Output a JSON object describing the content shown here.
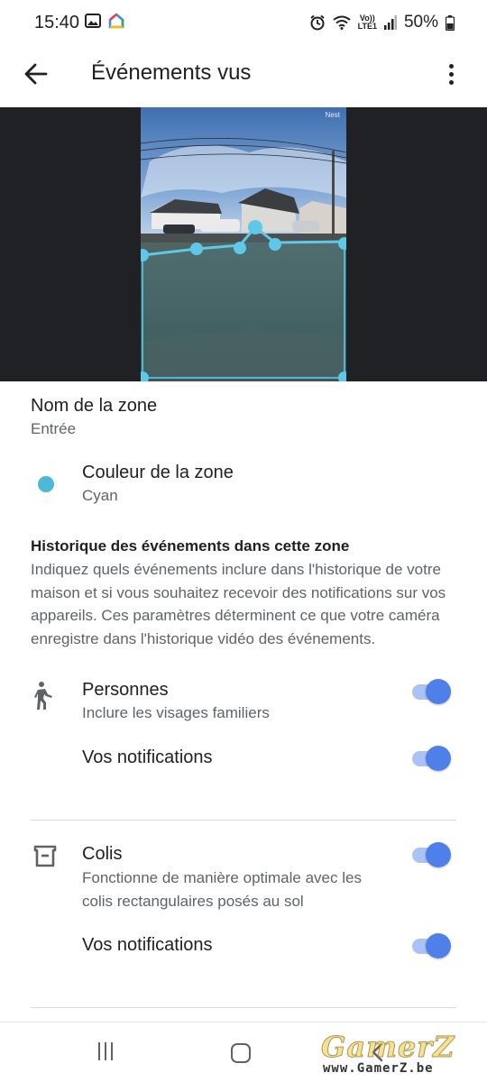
{
  "status_bar": {
    "time": "15:40",
    "battery": "50%",
    "volte_top": "Vo))",
    "volte_bottom": "LTE1",
    "icons": [
      "image-icon",
      "google-home-icon",
      "alarm-icon",
      "wifi-icon",
      "signal-icon",
      "battery-icon"
    ]
  },
  "app_bar": {
    "title": "Événements vus",
    "back_icon": "arrow-back-icon",
    "menu_icon": "more-vert-icon"
  },
  "camera": {
    "brand_label": "Nest",
    "zone_color": "#4fb8d6"
  },
  "zone_name": {
    "title": "Nom de la zone",
    "value": "Entrée"
  },
  "zone_color": {
    "title": "Couleur de la zone",
    "value": "Cyan",
    "color": "#4fb8d6"
  },
  "history": {
    "title": "Historique des événements dans cette zone",
    "description": "Indiquez quels événements inclure dans l'historique de votre maison et si vous souhaitez recevoir des notifications sur vos appareils. Ces paramètres déterminent ce que votre caméra enregistre dans l'historique vidéo des événements."
  },
  "persons": {
    "title": "Personnes",
    "subtitle": "Inclure les visages familiers",
    "enabled": true,
    "notifications_label": "Vos notifications",
    "notifications_enabled": true
  },
  "packages": {
    "title": "Colis",
    "subtitle": "Fonctionne de manière optimale avec les colis rectangulaires posés au sol",
    "enabled": true,
    "notifications_label": "Vos notifications",
    "notifications_enabled": true
  },
  "colors": {
    "toggle_thumb": "#4f80ea",
    "toggle_track": "#aac2f4",
    "camera_background": "#202124"
  },
  "watermark": {
    "logo": "GamerZ",
    "url": "www.GamerZ.be"
  }
}
